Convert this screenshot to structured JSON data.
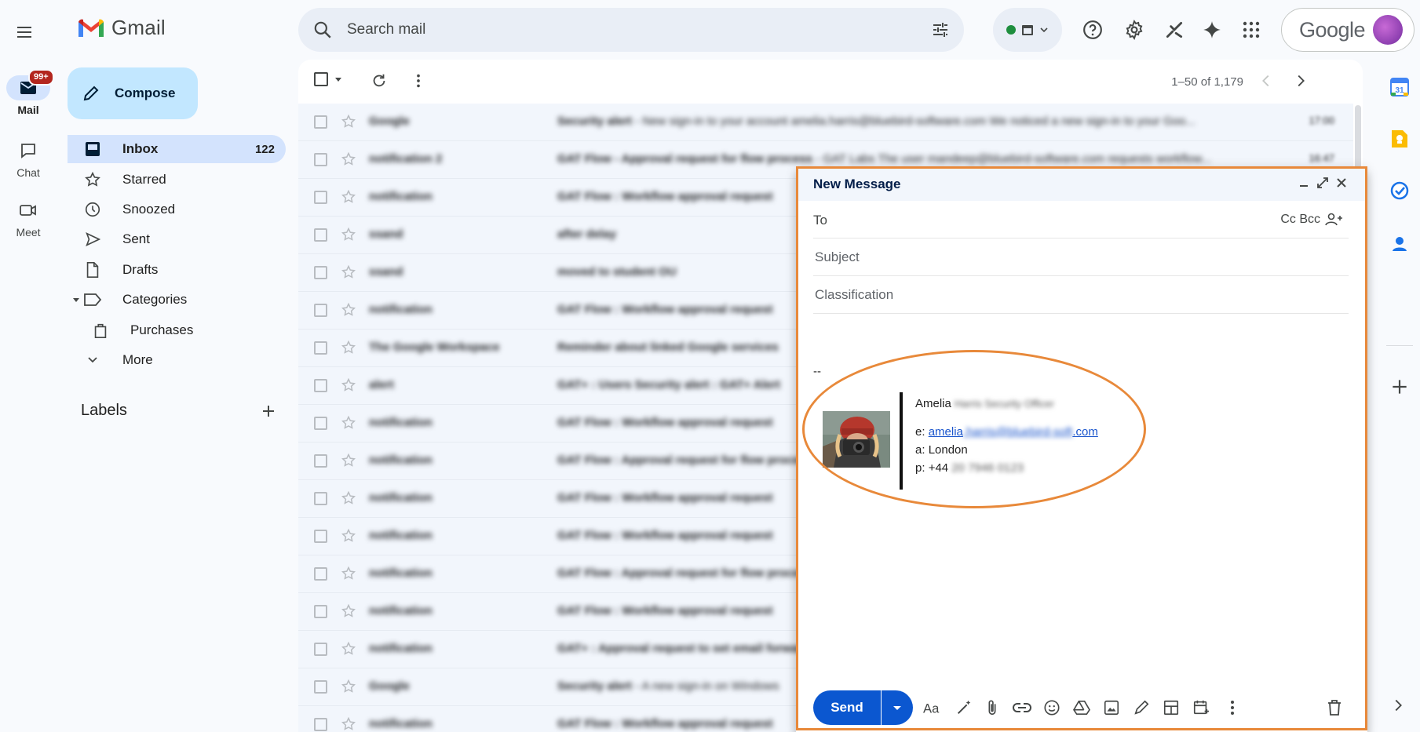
{
  "app": {
    "name": "Gmail"
  },
  "rail": {
    "mail_label": "Mail",
    "mail_badge": "99+",
    "chat_label": "Chat",
    "meet_label": "Meet"
  },
  "search": {
    "placeholder": "Search mail"
  },
  "account": {
    "brand": "Google"
  },
  "nav": {
    "compose_label": "Compose",
    "items": [
      {
        "label": "Inbox",
        "count": "122",
        "icon": "inbox-icon",
        "active": true
      },
      {
        "label": "Starred",
        "icon": "star-icon"
      },
      {
        "label": "Snoozed",
        "icon": "clock-icon"
      },
      {
        "label": "Sent",
        "icon": "send-icon"
      },
      {
        "label": "Drafts",
        "icon": "draft-icon"
      },
      {
        "label": "Categories",
        "icon": "label-icon"
      },
      {
        "label": "Purchases",
        "icon": "shopping-bag-icon"
      },
      {
        "label": "More",
        "icon": "chevron-down-icon"
      }
    ],
    "labels_header": "Labels"
  },
  "list": {
    "pagination": "1–50 of 1,179",
    "rows": [
      {
        "sender": "Google",
        "subject": "Security alert",
        "snippet": " - New sign-in to your account amelia.harris@bluebird-software.com We noticed a new sign-in to your Goo...",
        "time": "17:00"
      },
      {
        "sender": "notification 2",
        "subject": "GAT Flow - Approval request for flow process",
        "snippet": " - GAT Labs The user mandeep@bluebird-software.com requests workflow...",
        "time": "16:47"
      },
      {
        "sender": "notification",
        "subject": "GAT Flow : Workflow approval request",
        "snippet": "",
        "time": ""
      },
      {
        "sender": "ssand",
        "subject": "after delay",
        "snippet": "",
        "time": ""
      },
      {
        "sender": "ssand",
        "subject": "moved to student OU",
        "snippet": "",
        "time": ""
      },
      {
        "sender": "notification",
        "subject": "GAT Flow : Workflow approval request",
        "snippet": "",
        "time": ""
      },
      {
        "sender": "The Google Workspace",
        "subject": "Reminder about linked Google services",
        "snippet": "",
        "time": ""
      },
      {
        "sender": "alert",
        "subject": "GAT+ : Users Security alert : GAT+ Alert",
        "snippet": "",
        "time": ""
      },
      {
        "sender": "notification",
        "subject": "GAT Flow : Workflow approval request",
        "snippet": "",
        "time": ""
      },
      {
        "sender": "notification",
        "subject": "GAT Flow : Approval request for flow process",
        "snippet": "",
        "time": ""
      },
      {
        "sender": "notification",
        "subject": "GAT Flow : Workflow approval request",
        "snippet": "",
        "time": ""
      },
      {
        "sender": "notification",
        "subject": "GAT Flow : Workflow approval request",
        "snippet": "",
        "time": ""
      },
      {
        "sender": "notification",
        "subject": "GAT Flow : Approval request for flow process",
        "snippet": "",
        "time": ""
      },
      {
        "sender": "notification",
        "subject": "GAT Flow : Workflow approval request",
        "snippet": "",
        "time": ""
      },
      {
        "sender": "notification",
        "subject": "GAT+ : Approval request to set email forwarding",
        "snippet": "",
        "time": ""
      },
      {
        "sender": "Google",
        "subject": "Security alert",
        "snippet": " - A new sign-in on Windows",
        "time": ""
      },
      {
        "sender": "notification",
        "subject": "GAT Flow : Workflow approval request",
        "snippet": "",
        "time": ""
      }
    ]
  },
  "compose": {
    "title": "New Message",
    "to_label": "To",
    "cc_bcc": "Cc Bcc",
    "subject_placeholder": "Subject",
    "classification_placeholder": "Classification",
    "signature": {
      "dash": "--",
      "name": "Amelia",
      "name_blurred": "Harris Security Officer",
      "email_prefix": "e:",
      "email_visible": "amelia",
      "email_blurred": ".harris@bluebird-soft",
      "email_tail": ".com",
      "address_prefix": "a:",
      "address": "London",
      "phone_prefix": "p:",
      "phone_visible": "+44",
      "phone_blurred": " 20 7946 0123"
    },
    "send_label": "Send"
  },
  "colors": {
    "accent_blue": "#0b57d0",
    "nav_active": "#d3e3fd",
    "compose_button": "#c2e7ff",
    "annotation_orange": "#e8893a",
    "badge_red": "#b3261e"
  }
}
